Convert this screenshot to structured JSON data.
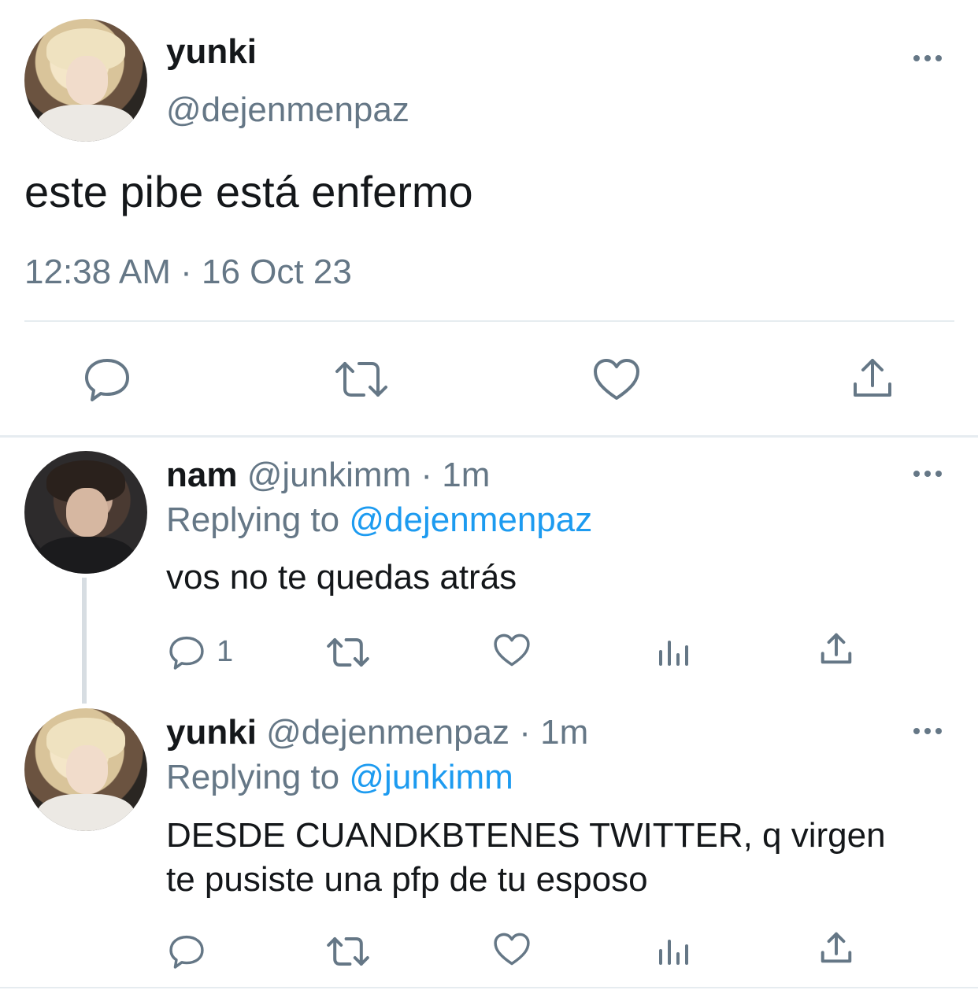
{
  "main_tweet": {
    "display_name": "yunki",
    "handle": "@dejenmenpaz",
    "text": "este pibe está enfermo",
    "timestamp": "12:38 AM · 16 Oct 23",
    "actions": [
      "reply-icon",
      "retweet-icon",
      "like-icon",
      "share-icon"
    ]
  },
  "replies": [
    {
      "display_name": "nam",
      "handle": "@junkimm",
      "time": "· 1m",
      "replying_prefix": "Replying to",
      "replying_to": "@dejenmenpaz",
      "text": "vos no te quedas atrás",
      "reply_count": "1"
    },
    {
      "display_name": "yunki",
      "handle": "@dejenmenpaz",
      "time": "· 1m",
      "replying_prefix": "Replying to",
      "replying_to": "@junkimm",
      "text_line1": "DESDE CUANDKBTENES TWITTER, q virgen",
      "text_line2": "te pusiste una pfp de tu esposo"
    }
  ],
  "colors": {
    "text": "#14171a",
    "muted": "#657786",
    "link": "#1d9bf0",
    "divider": "#e6ecf0"
  }
}
